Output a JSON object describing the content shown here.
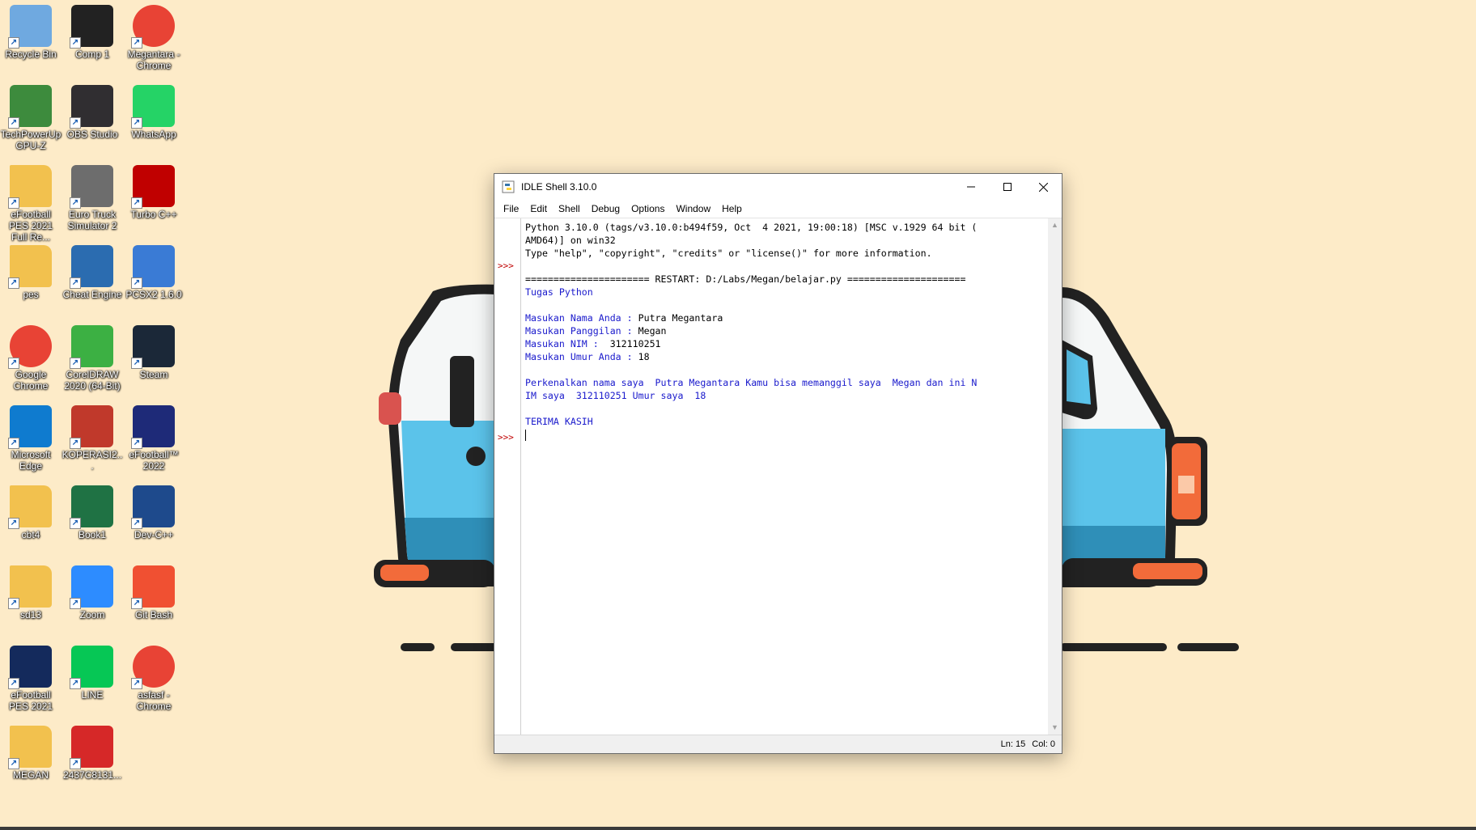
{
  "desktop": {
    "icons": [
      {
        "label": "Recycle Bin",
        "icon": "recycle-bin-icon",
        "color": "#6fa9e0"
      },
      {
        "label": "Comp 1",
        "icon": "monitor-icon",
        "color": "#222222"
      },
      {
        "label": "Megantara - Chrome",
        "icon": "chrome-profile-icon",
        "color": "#e84335"
      },
      {
        "label": "TechPowerUp GPU-Z",
        "icon": "gpuz-icon",
        "color": "#3d8b3d"
      },
      {
        "label": "OBS Studio",
        "icon": "obs-icon",
        "color": "#302e31"
      },
      {
        "label": "WhatsApp",
        "icon": "whatsapp-icon",
        "color": "#25d366"
      },
      {
        "label": "eFootball PES 2021 Full Re...",
        "icon": "folder-icon",
        "color": "#f2c14e"
      },
      {
        "label": "Euro Truck Simulator 2",
        "icon": "truck-icon",
        "color": "#6d6d6d"
      },
      {
        "label": "Turbo C++",
        "icon": "turbo-cpp-icon",
        "color": "#c00000"
      },
      {
        "label": "pes",
        "icon": "folder-icon",
        "color": "#f2c14e"
      },
      {
        "label": "Cheat Engine",
        "icon": "cheat-engine-icon",
        "color": "#2b6cb0"
      },
      {
        "label": "PCSX2 1.6.0",
        "icon": "pcsx2-icon",
        "color": "#3a7bd5"
      },
      {
        "label": "Google Chrome",
        "icon": "chrome-icon",
        "color": "#e84335"
      },
      {
        "label": "CorelDRAW 2020 (64-Bit)",
        "icon": "coreldraw-icon",
        "color": "#3cb043"
      },
      {
        "label": "Steam",
        "icon": "steam-icon",
        "color": "#1b2838"
      },
      {
        "label": "Microsoft Edge",
        "icon": "edge-icon",
        "color": "#0f7bcf"
      },
      {
        "label": "KOPERASI2...",
        "icon": "access-icon",
        "color": "#c0392b"
      },
      {
        "label": "eFootball™ 2022",
        "icon": "efootball-icon",
        "color": "#1e2a78"
      },
      {
        "label": "cbt4",
        "icon": "folder-icon",
        "color": "#f2c14e"
      },
      {
        "label": "Book1",
        "icon": "excel-icon",
        "color": "#1f7244"
      },
      {
        "label": "Dev-C++",
        "icon": "devcpp-icon",
        "color": "#1e4a8c"
      },
      {
        "label": "sd13",
        "icon": "folder-icon",
        "color": "#f2c14e"
      },
      {
        "label": "Zoom",
        "icon": "zoom-icon",
        "color": "#2d8cff"
      },
      {
        "label": "Git Bash",
        "icon": "git-bash-icon",
        "color": "#f05032"
      },
      {
        "label": "eFootball PES 2021",
        "icon": "pes2021-icon",
        "color": "#142a5c"
      },
      {
        "label": "LINE",
        "icon": "line-icon",
        "color": "#06c755"
      },
      {
        "label": "asfasf - Chrome",
        "icon": "chrome-profile-icon",
        "color": "#e84335"
      },
      {
        "label": "MEGAN",
        "icon": "folder-icon",
        "color": "#f2c14e"
      },
      {
        "label": "2437C8131...",
        "icon": "pdf-icon",
        "color": "#d62828"
      }
    ]
  },
  "window": {
    "title": "IDLE Shell 3.10.0",
    "menu": [
      "File",
      "Edit",
      "Shell",
      "Debug",
      "Options",
      "Window",
      "Help"
    ],
    "prompt": ">>>",
    "lines": [
      {
        "text": "Python 3.10.0 (tags/v3.10.0:b494f59, Oct  4 2021, 19:00:18) [MSC v.1929 64 bit (",
        "color": "black"
      },
      {
        "text": "AMD64)] on win32",
        "color": "black"
      },
      {
        "text": "Type \"help\", \"copyright\", \"credits\" or \"license()\" for more information.",
        "color": "black"
      },
      {
        "text": "",
        "color": "black"
      },
      {
        "text": "====================== RESTART: D:/Labs/Megan/belajar.py =====================",
        "color": "black"
      },
      {
        "text": "Tugas Python",
        "color": "blue"
      },
      {
        "text": "",
        "color": "black"
      },
      {
        "prompt": "Masukan Nama Anda : ",
        "input": "Putra Megantara"
      },
      {
        "prompt": "Masukan Panggilan : ",
        "input": "Megan"
      },
      {
        "prompt": "Masukan NIM :  ",
        "input": "312110251"
      },
      {
        "prompt": "Masukan Umur Anda : ",
        "input": "18"
      },
      {
        "text": "",
        "color": "black"
      },
      {
        "text": "Perkenalkan nama saya  Putra Megantara Kamu bisa memanggil saya  Megan dan ini N",
        "color": "blue"
      },
      {
        "text": "IM saya  312110251 Umur saya  18",
        "color": "blue"
      },
      {
        "text": "",
        "color": "black"
      },
      {
        "text": "TERIMA KASIH",
        "color": "blue"
      }
    ],
    "status": {
      "line": "Ln: 15",
      "col": "Col: 0"
    },
    "colors": {
      "output": "#1a1acc",
      "prompt": "#c00000"
    }
  }
}
